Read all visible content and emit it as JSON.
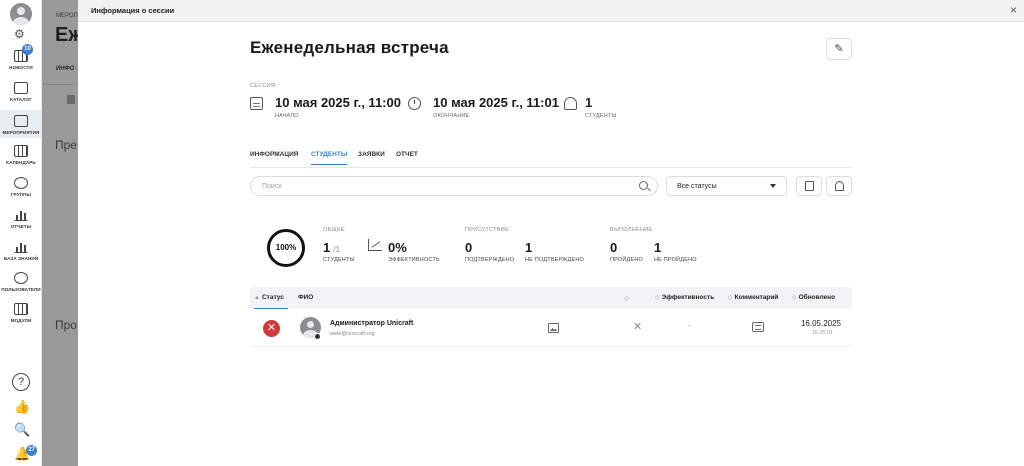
{
  "sidebar": {
    "items": [
      {
        "label": "НОВОСТИ",
        "icon": "news-icon",
        "badge": "10"
      },
      {
        "label": "КАТАЛОГ",
        "icon": "catalog-icon"
      },
      {
        "label": "МЕРОПРИЯТИЯ",
        "icon": "events-icon",
        "active": true
      },
      {
        "label": "КАЛЕНДАРЬ",
        "icon": "calendar-icon"
      },
      {
        "label": "ГРУППЫ",
        "icon": "groups-icon"
      },
      {
        "label": "ОТЧЕТЫ",
        "icon": "reports-icon"
      },
      {
        "label": "БАЗА ЗНАНИЙ",
        "icon": "knowledge-base-icon"
      },
      {
        "label": "ПОЛЬЗОВАТЕЛИ",
        "icon": "users-icon"
      },
      {
        "label": "МОДУЛИ",
        "icon": "modules-icon"
      }
    ],
    "help_glyph": "?",
    "notifications_badge": "27"
  },
  "backdrop": {
    "crumb": "МЕРОП",
    "title": "Еж",
    "tab": "ИНФО",
    "heading1": "Пре",
    "heading2": "Про"
  },
  "modal": {
    "title": "Информация о сессии",
    "close_glyph": "×"
  },
  "event": {
    "title": "Еженедельная встреча",
    "edit_glyph": "✎"
  },
  "session": {
    "section_label": "СЕССИЯ",
    "start_value": "10 мая 2025 г., 11:00",
    "start_label": "НАЧАЛО",
    "end_value": "10 мая 2025 г., 11:01",
    "end_label": "ОКОНЧАНИЕ",
    "students_value": "1",
    "students_label": "СТУДЕНТЫ"
  },
  "tabs": [
    {
      "label": "ИНФОРМАЦИЯ"
    },
    {
      "label": "СТУДЕНТЫ",
      "active": true
    },
    {
      "label": "ЗАЯВКИ"
    },
    {
      "label": "ОТЧЕТ"
    }
  ],
  "filters": {
    "search_placeholder": "Поиск",
    "status_value": "Все статусы"
  },
  "stats": {
    "ring_percent": "100%",
    "overall_header": "ОБЩЕЕ",
    "students_count": "1",
    "students_total": "/1",
    "students_label": "СТУДЕНТЫ",
    "efficiency_value": "0%",
    "efficiency_label": "ЭФФЕКТИВНОСТЬ",
    "attendance_header": "ПРИСУТСТВИЕ",
    "confirmed_value": "0",
    "confirmed_label": "ПОДТВЕРЖДЕНО",
    "not_confirmed_value": "1",
    "not_confirmed_label": "НЕ ПОДТВЕРЖДЕНО",
    "completion_header": "ВЫПОЛНЕНИЕ",
    "passed_value": "0",
    "passed_label": "ПРОЙДЕНО",
    "not_passed_value": "1",
    "not_passed_label": "НЕ ПРОЙДЕНО"
  },
  "table": {
    "columns": {
      "status": "Статус",
      "name": "ФИО",
      "efficiency": "Эффективность",
      "comment": "Комментарий",
      "updated": "Обновлено"
    },
    "rows": [
      {
        "status_glyph": "✕",
        "name": "Администратор Unicraft",
        "email": "siete@unicraft.org",
        "x_glyph": "✕",
        "efficiency": "-",
        "updated_date": "16.05.2025",
        "updated_time": "15:25:01"
      }
    ]
  },
  "colors": {
    "accent": "#3d7fc9",
    "fail": "#d23a3a"
  }
}
